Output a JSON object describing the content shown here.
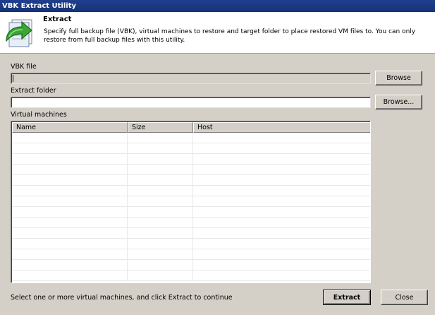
{
  "window": {
    "title": "VBK Extract Utility"
  },
  "header": {
    "title": "Extract",
    "description": "Specify full backup file (VBK), virtual machines to restore and target folder to place restored VM files to. You can only restore from full backup files with this utility.",
    "icon": "extract-arrow-icon"
  },
  "vbk_file": {
    "label": "VBK file",
    "value": "",
    "browse_label": "Browse"
  },
  "extract_folder": {
    "label": "Extract folder",
    "value": "",
    "browse_label": "Browse..."
  },
  "virtual_machines": {
    "label": "Virtual machines",
    "columns": [
      "Name",
      "Size",
      "Host"
    ],
    "rows": []
  },
  "footer": {
    "hint": "Select one or more virtual machines, and click Extract to continue",
    "extract_label": "Extract",
    "close_label": "Close"
  },
  "colors": {
    "titlebar": "#1f3f8f",
    "dialog_bg": "#d4d0c8",
    "icon_arrow": "#3aa635"
  }
}
